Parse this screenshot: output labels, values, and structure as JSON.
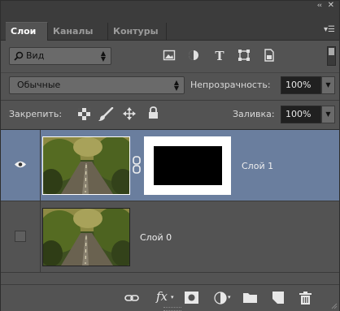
{
  "window": {
    "collapse_glyph": "‹‹",
    "close_glyph": "✕"
  },
  "tabs": [
    {
      "label": "Слои",
      "active": true
    },
    {
      "label": "Каналы",
      "active": false
    },
    {
      "label": "Контуры",
      "active": false
    }
  ],
  "filter": {
    "label": "Вид",
    "icons": [
      "pixel-filter-icon",
      "adjustment-filter-icon",
      "type-filter-icon",
      "shape-filter-icon",
      "smart-object-filter-icon"
    ]
  },
  "blend": {
    "mode": "Обычные",
    "opacity_label": "Непрозрачность:",
    "opacity_value": "100%"
  },
  "lock": {
    "label": "Закрепить:",
    "icons": [
      "lock-transparent-icon",
      "lock-image-icon",
      "lock-position-icon",
      "lock-all-icon"
    ],
    "fill_label": "Заливка:",
    "fill_value": "100%"
  },
  "layers": [
    {
      "name": "Слой 1",
      "visible": true,
      "selected": true,
      "has_mask": true
    },
    {
      "name": "Слой 0",
      "visible": false,
      "selected": false,
      "has_mask": false
    }
  ],
  "bottom_icons": [
    "link-layers-icon",
    "fx-icon",
    "add-mask-icon",
    "adjustment-layer-icon",
    "new-group-icon",
    "new-layer-icon",
    "delete-icon"
  ],
  "bottom_fx_text": "fx",
  "colors": {
    "panel": "#535353",
    "selected_row": "#6a7e9e",
    "tab_bar": "#3c3c3c"
  }
}
